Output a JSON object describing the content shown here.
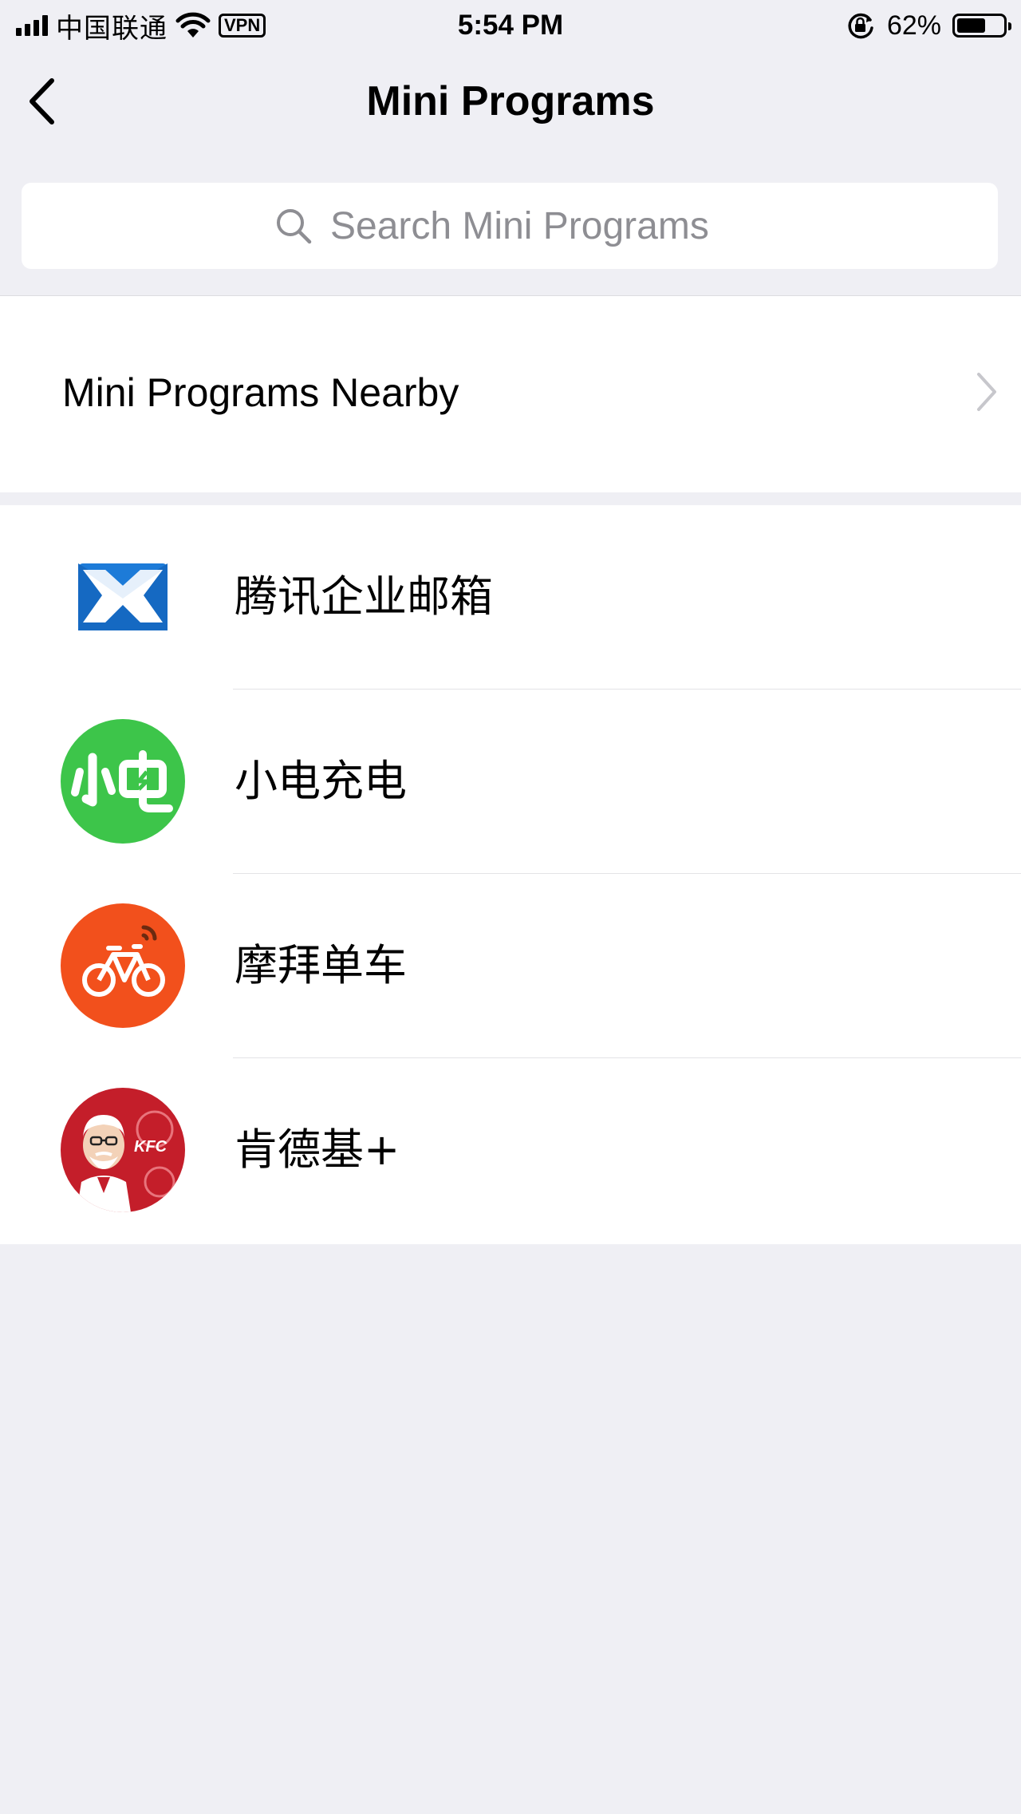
{
  "status_bar": {
    "carrier": "中国联通",
    "vpn": "VPN",
    "time": "5:54 PM",
    "battery_percent": "62%",
    "battery_level": 0.62,
    "icons": [
      "signal-icon",
      "wifi-icon",
      "rotation-lock-icon",
      "battery-icon"
    ]
  },
  "header": {
    "title": "Mini Programs",
    "back_icon": "chevron-left-icon"
  },
  "search": {
    "placeholder": "Search Mini Programs",
    "value": "",
    "icon": "search-icon"
  },
  "nearby": {
    "label": "Mini Programs Nearby",
    "icon": "chevron-right-icon"
  },
  "apps": [
    {
      "name": "腾讯企业邮箱",
      "icon": "tencent-exmail-icon",
      "color": "#1d7bd8"
    },
    {
      "name": "小电充电",
      "icon": "xiaodian-icon",
      "color": "#3dc54a"
    },
    {
      "name": "摩拜单车",
      "icon": "mobike-icon",
      "color": "#f2501c"
    },
    {
      "name": "肯德基+",
      "icon": "kfc-icon",
      "color": "#c41e2a"
    }
  ],
  "colors": {
    "background": "#efeff4",
    "surface": "#ffffff",
    "placeholder": "#8e8e93",
    "chevron": "#c7c7cc"
  }
}
